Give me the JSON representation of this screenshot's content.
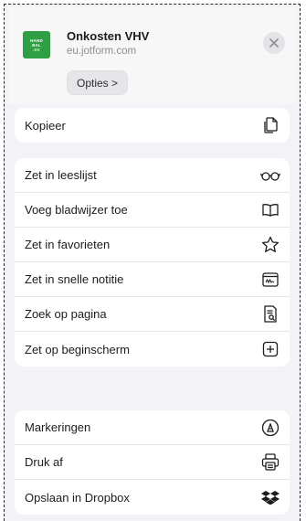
{
  "header": {
    "site_title": "Onkosten VHV",
    "site_url": "eu.jotform.com",
    "options_label": "Opties >",
    "app_icon_text": [
      "HAND",
      "BAL",
      ".BE"
    ]
  },
  "groups": [
    {
      "items": [
        {
          "label": "Kopieer",
          "icon": "copy-icon"
        }
      ]
    },
    {
      "items": [
        {
          "label": "Zet in leeslijst",
          "icon": "glasses-icon"
        },
        {
          "label": "Voeg bladwijzer toe",
          "icon": "book-icon"
        },
        {
          "label": "Zet in favorieten",
          "icon": "star-icon"
        },
        {
          "label": "Zet in snelle notitie",
          "icon": "quick-note-icon"
        },
        {
          "label": "Zoek op pagina",
          "icon": "find-in-page-icon"
        },
        {
          "label": "Zet op beginscherm",
          "icon": "add-to-home-icon"
        }
      ]
    },
    {
      "items": [
        {
          "label": "Markeringen",
          "icon": "markup-icon"
        },
        {
          "label": "Druk af",
          "icon": "printer-icon"
        },
        {
          "label": "Opslaan in Dropbox",
          "icon": "dropbox-icon"
        }
      ]
    }
  ],
  "colors": {
    "accent_green": "#2f9e44",
    "background": "#f2f2f7"
  }
}
